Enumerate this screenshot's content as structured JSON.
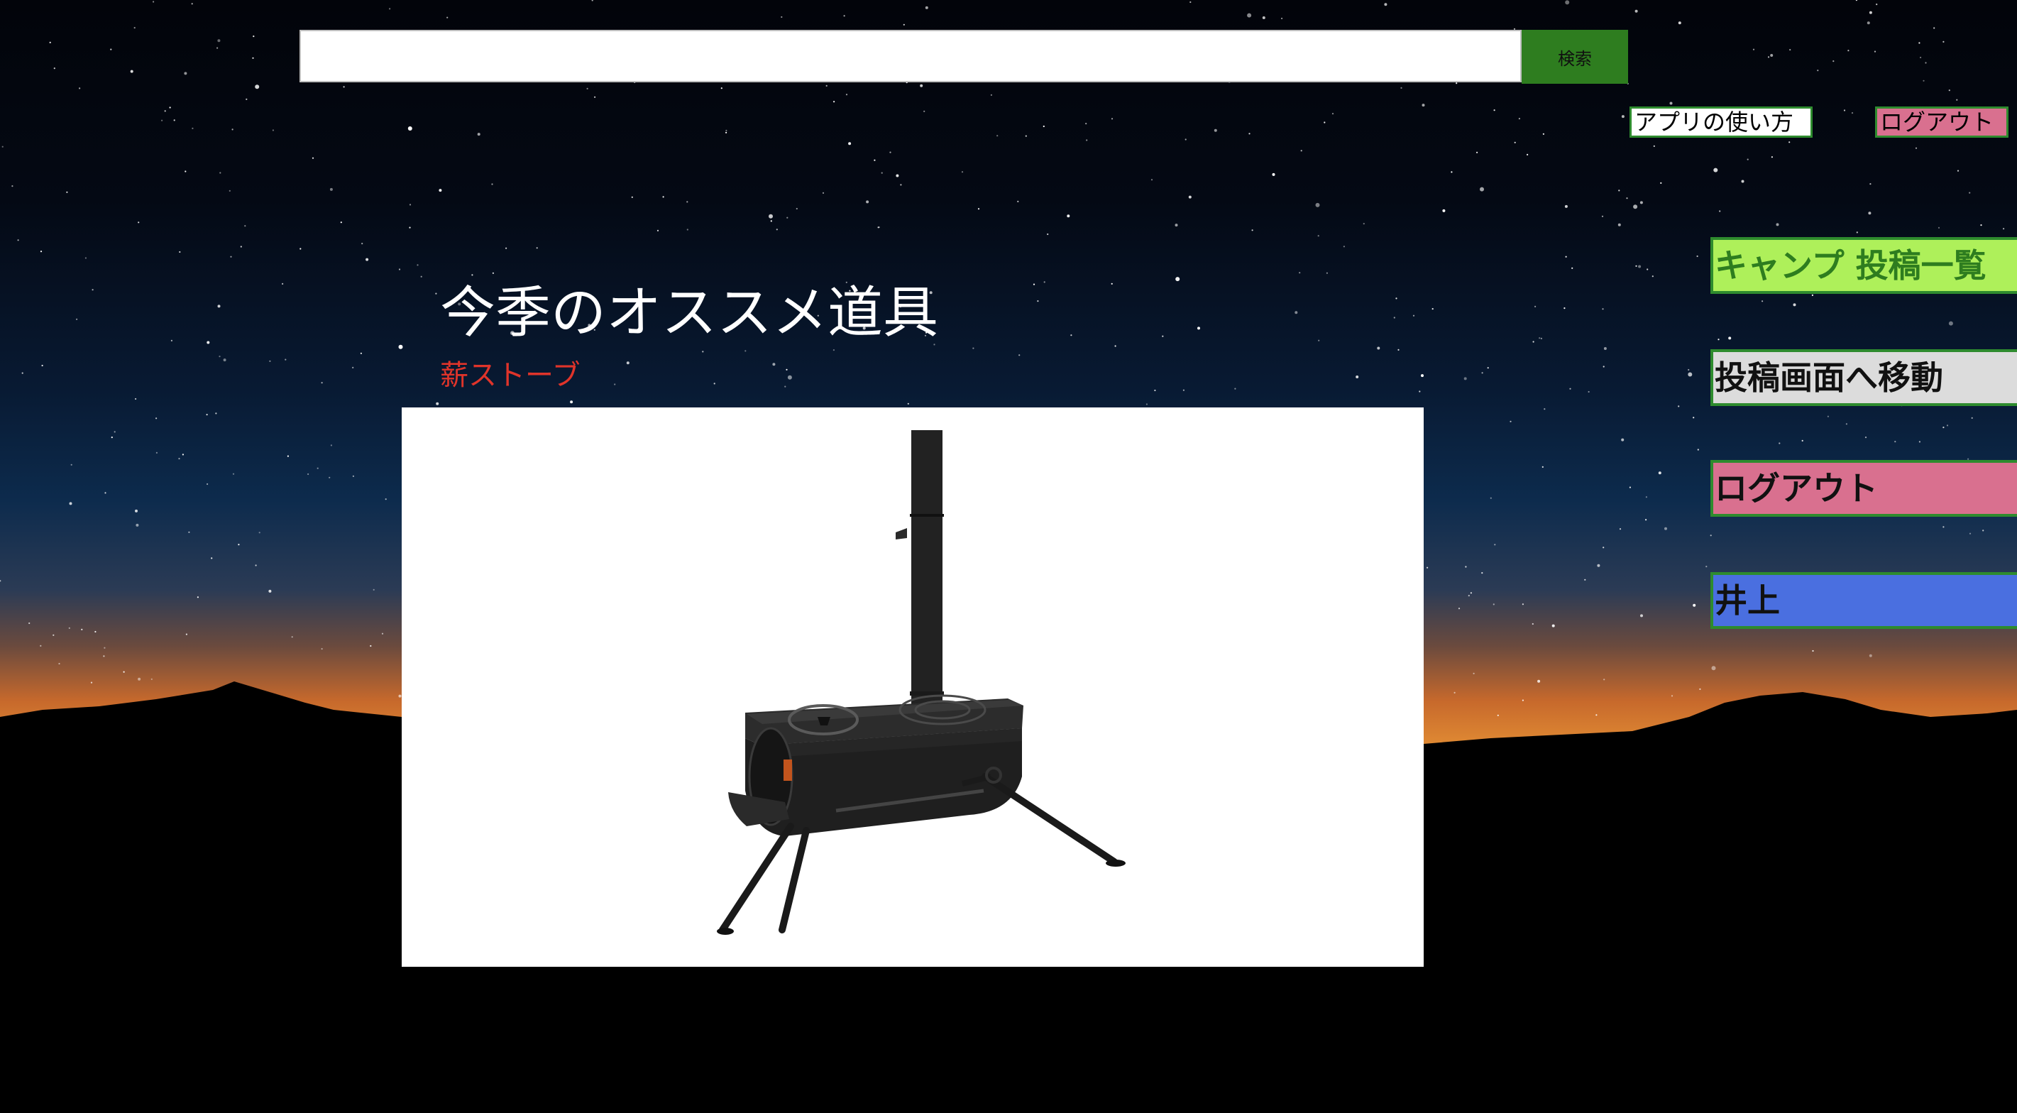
{
  "search": {
    "value": "",
    "placeholder": "",
    "button_label": "検索"
  },
  "header_links": {
    "howto_label": "アプリの使い方",
    "logout_label": "ログアウト"
  },
  "sidebar": {
    "items": [
      {
        "label": "キャンプ 投稿一覧",
        "color": "#aef05a"
      },
      {
        "label": "投稿画面へ移動",
        "color": "#dcdcdc"
      },
      {
        "label": "ログアウト",
        "color": "#d9708f"
      },
      {
        "label": "井上",
        "color": "#4a6fe0"
      }
    ]
  },
  "recommendation": {
    "title": "今季のオススメ道具",
    "item_name": "薪ストーブ",
    "image_icon": "wood-stove-image"
  },
  "colors": {
    "accent_green": "#2e7d1f",
    "border_green": "#2e8b2e",
    "item_name_red": "#e0342a"
  }
}
